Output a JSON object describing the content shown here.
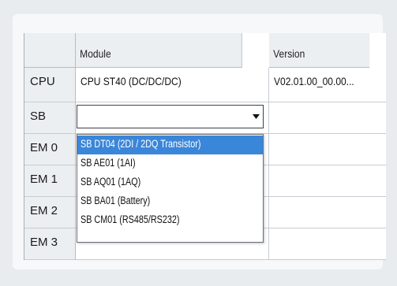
{
  "table": {
    "headers": {
      "module": "Module",
      "version": "Version"
    },
    "rows": [
      {
        "label": "CPU",
        "module": "CPU ST40 (DC/DC/DC)",
        "version": "V02.01.00_00.00..."
      },
      {
        "label": "SB",
        "module": "",
        "version": ""
      },
      {
        "label": "EM 0",
        "module": "",
        "version": ""
      },
      {
        "label": "EM 1",
        "module": "",
        "version": ""
      },
      {
        "label": "EM 2",
        "module": "",
        "version": ""
      },
      {
        "label": "EM 3",
        "module": "",
        "version": ""
      }
    ]
  },
  "dropdown": {
    "selected_index": 0,
    "options": [
      "SB DT04 (2DI / 2DQ Transistor)",
      "SB AE01 (1AI)",
      "SB AQ01 (1AQ)",
      "SB BA01 (Battery)",
      "SB CM01 (RS485/RS232)"
    ]
  },
  "colors": {
    "selection": "#3a86d9",
    "header_bg": "#eceff2",
    "page_bg": "#e9ecef"
  },
  "icons": {
    "combo_arrow": "triangle-down-icon"
  }
}
